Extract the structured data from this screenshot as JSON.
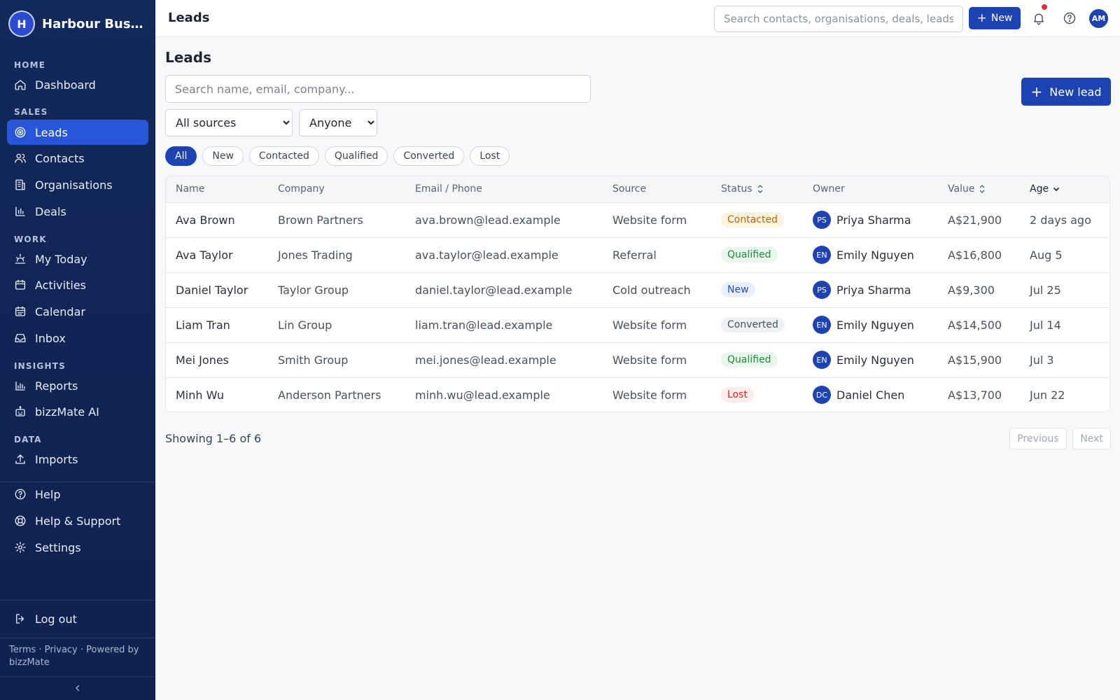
{
  "brand": {
    "initial": "H",
    "name": "Harbour Business"
  },
  "sidebar": {
    "sections": {
      "home": "HOME",
      "sales": "SALES",
      "work": "WORK",
      "insights": "INSIGHTS",
      "data": "DATA"
    },
    "items": {
      "dashboard": "Dashboard",
      "leads": "Leads",
      "contacts": "Contacts",
      "organisations": "Organisations",
      "deals": "Deals",
      "my_today": "My Today",
      "activities": "Activities",
      "calendar": "Calendar",
      "inbox": "Inbox",
      "reports": "Reports",
      "bizzmate_ai": "bizzMate AI",
      "imports": "Imports",
      "help": "Help",
      "help_support": "Help & Support",
      "settings": "Settings",
      "logout": "Log out"
    },
    "active": "leads",
    "footer": "Terms · Privacy · Powered by bizzMate"
  },
  "topbar": {
    "title": "Leads",
    "search_placeholder": "Search contacts, organisations, deals, leads...",
    "new_label": "New",
    "user_initials": "AM"
  },
  "main": {
    "title": "Leads",
    "search_placeholder": "Search name, email, company...",
    "new_lead_label": "New lead",
    "source_filter": {
      "selected": "All sources"
    },
    "owner_filter": {
      "selected": "Anyone"
    },
    "status_chips": [
      "All",
      "New",
      "Contacted",
      "Qualified",
      "Converted",
      "Lost"
    ],
    "active_chip": "All"
  },
  "table": {
    "columns": [
      "Name",
      "Company",
      "Email / Phone",
      "Source",
      "Status",
      "Owner",
      "Value",
      "Age"
    ],
    "rows": [
      {
        "name": "Ava Brown",
        "company": "Brown Partners",
        "email": "ava.brown@lead.example",
        "source": "Website form",
        "status": "Contacted",
        "owner_initials": "PS",
        "owner": "Priya Sharma",
        "value": "A$21,900",
        "age": "2 days ago"
      },
      {
        "name": "Ava Taylor",
        "company": "Jones Trading",
        "email": "ava.taylor@lead.example",
        "source": "Referral",
        "status": "Qualified",
        "owner_initials": "EN",
        "owner": "Emily Nguyen",
        "value": "A$16,800",
        "age": "Aug 5"
      },
      {
        "name": "Daniel Taylor",
        "company": "Taylor Group",
        "email": "daniel.taylor@lead.example",
        "source": "Cold outreach",
        "status": "New",
        "owner_initials": "PS",
        "owner": "Priya Sharma",
        "value": "A$9,300",
        "age": "Jul 25"
      },
      {
        "name": "Liam Tran",
        "company": "Lin Group",
        "email": "liam.tran@lead.example",
        "source": "Website form",
        "status": "Converted",
        "owner_initials": "EN",
        "owner": "Emily Nguyen",
        "value": "A$14,500",
        "age": "Jul 14"
      },
      {
        "name": "Mei Jones",
        "company": "Smith Group",
        "email": "mei.jones@lead.example",
        "source": "Website form",
        "status": "Qualified",
        "owner_initials": "EN",
        "owner": "Emily Nguyen",
        "value": "A$15,900",
        "age": "Jul 3"
      },
      {
        "name": "Minh Wu",
        "company": "Anderson Partners",
        "email": "minh.wu@lead.example",
        "source": "Website form",
        "status": "Lost",
        "owner_initials": "DC",
        "owner": "Daniel Chen",
        "value": "A$13,700",
        "age": "Jun 22"
      }
    ]
  },
  "status_colors": {
    "Contacted": {
      "bg": "#fdf3e1",
      "fg": "#b7650b"
    },
    "Qualified": {
      "bg": "#e8f6ec",
      "fg": "#1f8a3f"
    },
    "New": {
      "bg": "#e9effc",
      "fg": "#2350c0"
    },
    "Converted": {
      "bg": "#eff1f4",
      "fg": "#4a505c"
    },
    "Lost": {
      "bg": "#fdecec",
      "fg": "#c92a2a"
    }
  },
  "pagination": {
    "summary": "Showing 1–6 of 6",
    "previous": "Previous",
    "next": "Next"
  },
  "colors": {
    "sidebar_bg": "#12295a",
    "accent": "#1d43b3",
    "active_nav": "#2757d8",
    "notification": "#e03131"
  }
}
